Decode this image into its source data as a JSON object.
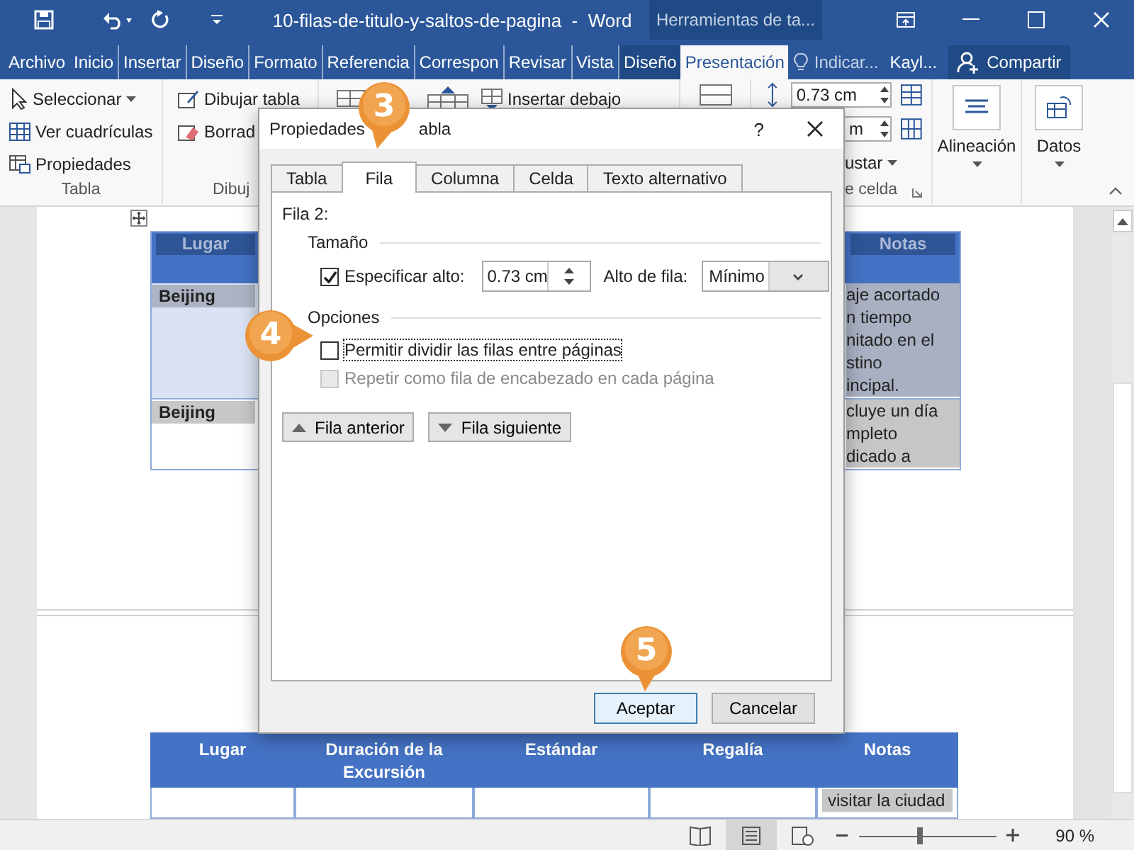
{
  "window": {
    "title": "10-filas-de-titulo-y-saltos-de-pagina  -  Word",
    "context_tab": "Herramientas de ta..."
  },
  "ribbon_tabs": [
    {
      "label": "Archivo",
      "selected": false,
      "contextual": false
    },
    {
      "label": "Inicio",
      "selected": false,
      "contextual": false
    },
    {
      "label": "Insertar",
      "selected": false,
      "contextual": false
    },
    {
      "label": "Diseño",
      "selected": false,
      "contextual": false
    },
    {
      "label": "Formato",
      "selected": false,
      "contextual": false
    },
    {
      "label": "Referencia",
      "selected": false,
      "contextual": false
    },
    {
      "label": "Correspon",
      "selected": false,
      "contextual": false
    },
    {
      "label": "Revisar",
      "selected": false,
      "contextual": false
    },
    {
      "label": "Vista",
      "selected": false,
      "contextual": false
    },
    {
      "label": "Diseño",
      "selected": false,
      "contextual": true
    },
    {
      "label": "Presentación",
      "selected": true,
      "contextual": true
    }
  ],
  "tell_me": "Indicar...",
  "user": "Kayl...",
  "share": "Compartir",
  "ribbon": {
    "table_group": {
      "label": "Tabla",
      "items": [
        "Seleccionar",
        "Ver cuadrículas",
        "Propiedades"
      ]
    },
    "draw_group": {
      "label": "Dibuj",
      "items": [
        "Dibujar tabla",
        "Borrad"
      ]
    },
    "insert_below": "Insertar debajo",
    "cell_size_group": {
      "height": "0.73 cm",
      "width": "m",
      "autofit": "ustar",
      "label": "e celda"
    },
    "alignment": "Alineación",
    "data": "Datos"
  },
  "document": {
    "top_table": {
      "left_header": "Lugar",
      "right_header": "Notas",
      "rows": [
        {
          "place": "Beijing",
          "notes": [
            "aje acortado",
            "n tiempo",
            "nitado en el",
            "stino",
            "incipal."
          ]
        },
        {
          "place": "Beijing",
          "notes": [
            "cluye un día",
            "mpleto",
            "dicado a"
          ]
        }
      ]
    },
    "bottom_table": {
      "columns": [
        "Lugar",
        "Duración de la Excursión",
        "Estándar",
        "Regalía",
        "Notas"
      ],
      "notes": "visitar la ciudad"
    }
  },
  "dialog": {
    "title_parts": [
      "Propiedades",
      "abla"
    ],
    "help": "?",
    "tabs": [
      {
        "label": "Tabla",
        "selected": false
      },
      {
        "label": "Fila",
        "selected": true
      },
      {
        "label": "Columna",
        "selected": false
      },
      {
        "label": "Celda",
        "selected": false
      },
      {
        "label": "Texto alternativo",
        "selected": false
      }
    ],
    "row_label": "Fila 2:",
    "size_section": "Tamaño",
    "specify_height": {
      "label": "Especificar alto:",
      "checked": true
    },
    "height_value": "0.73 cm",
    "row_height_label": "Alto de fila:",
    "row_height_mode": "Mínimo",
    "options_section": "Opciones",
    "options": [
      {
        "label": "Permitir dividir las filas entre páginas",
        "checked": false,
        "disabled": false,
        "focused": true
      },
      {
        "label": "Repetir como fila de encabezado en cada página",
        "checked": false,
        "disabled": true,
        "focused": false
      }
    ],
    "nav_buttons": [
      "Fila anterior",
      "Fila siguiente"
    ],
    "ok": "Aceptar",
    "cancel": "Cancelar"
  },
  "callouts": [
    {
      "number": "3"
    },
    {
      "number": "4"
    },
    {
      "number": "5"
    }
  ],
  "status_bar": {
    "views": [
      {
        "selected": false
      },
      {
        "selected": true
      },
      {
        "selected": false
      }
    ],
    "zoom_slider": {
      "level": 0.45
    },
    "zoom": "90 %"
  }
}
